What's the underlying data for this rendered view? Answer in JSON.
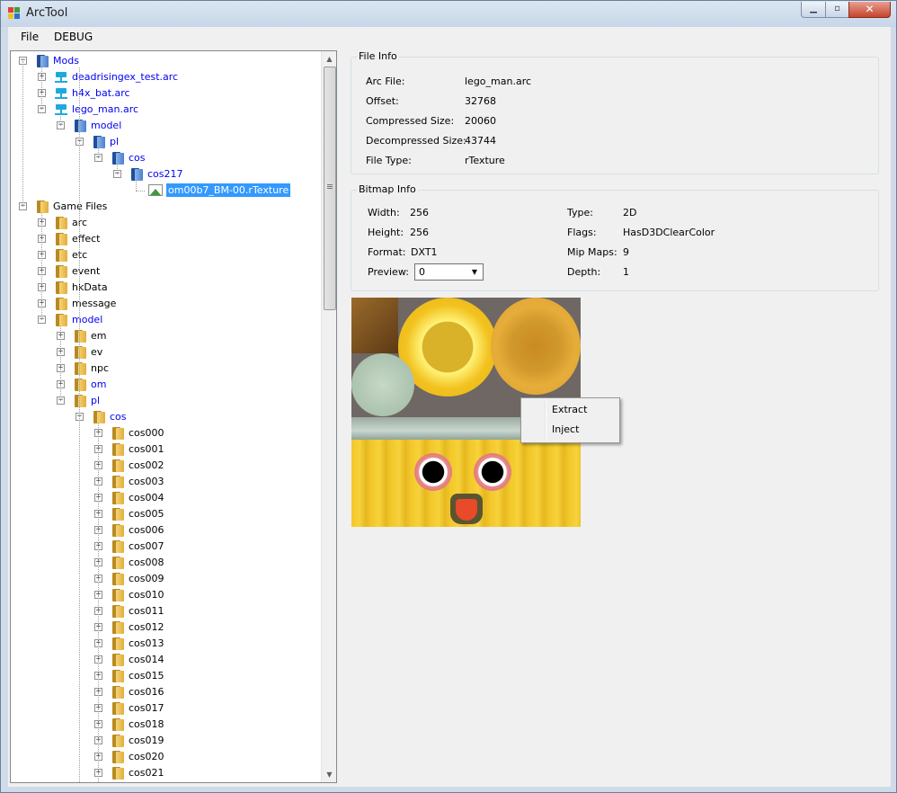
{
  "window": {
    "title": "ArcTool",
    "min_symbol": "▁",
    "max_symbol": "▫",
    "close_symbol": "✕"
  },
  "menu": [
    "File",
    "DEBUG"
  ],
  "tree": {
    "nodes": [
      {
        "label": "Mods",
        "expander": "−",
        "icon": "blue-folder-icon",
        "blue": true
      },
      {
        "label": "deadrisingex_test.arc",
        "expander": "+",
        "icon": "archive-icon",
        "blue": true
      },
      {
        "label": "h4x_bat.arc",
        "expander": "+",
        "icon": "archive-icon",
        "blue": true
      },
      {
        "label": "lego_man.arc",
        "expander": "−",
        "icon": "archive-icon",
        "blue": true
      },
      {
        "label": "model",
        "expander": "−",
        "icon": "blue-folder-icon",
        "blue": true
      },
      {
        "label": "pl",
        "expander": "−",
        "icon": "blue-folder-icon",
        "blue": true
      },
      {
        "label": "cos",
        "expander": "−",
        "icon": "blue-folder-icon",
        "blue": true
      },
      {
        "label": "cos217",
        "expander": "−",
        "icon": "blue-folder-icon",
        "blue": true
      },
      {
        "label": "om00b7_BM-00.rTexture",
        "expander": "",
        "icon": "image-icon",
        "blue": false,
        "selected": true
      },
      {
        "label": "Game Files",
        "expander": "−",
        "icon": "yellow-folder-icon",
        "blue": false
      },
      {
        "label": "arc",
        "expander": "+",
        "icon": "yellow-folder-icon",
        "blue": false
      },
      {
        "label": "effect",
        "expander": "+",
        "icon": "yellow-folder-icon",
        "blue": false
      },
      {
        "label": "etc",
        "expander": "+",
        "icon": "yellow-folder-icon",
        "blue": false
      },
      {
        "label": "event",
        "expander": "+",
        "icon": "yellow-folder-icon",
        "blue": false
      },
      {
        "label": "hkData",
        "expander": "+",
        "icon": "yellow-folder-icon",
        "blue": false
      },
      {
        "label": "message",
        "expander": "+",
        "icon": "yellow-folder-icon",
        "blue": false
      },
      {
        "label": "model",
        "expander": "−",
        "icon": "yellow-folder-icon",
        "blue": true
      },
      {
        "label": "em",
        "expander": "+",
        "icon": "yellow-folder-icon",
        "blue": false
      },
      {
        "label": "ev",
        "expander": "+",
        "icon": "yellow-folder-icon",
        "blue": false
      },
      {
        "label": "npc",
        "expander": "+",
        "icon": "yellow-folder-icon",
        "blue": false
      },
      {
        "label": "om",
        "expander": "+",
        "icon": "yellow-folder-icon",
        "blue": true
      },
      {
        "label": "pl",
        "expander": "−",
        "icon": "yellow-folder-icon",
        "blue": true
      },
      {
        "label": "cos",
        "expander": "−",
        "icon": "yellow-folder-icon",
        "blue": true
      },
      {
        "label": "cos000",
        "expander": "+",
        "icon": "yellow-folder-icon",
        "blue": false
      },
      {
        "label": "cos001",
        "expander": "+",
        "icon": "yellow-folder-icon",
        "blue": false
      },
      {
        "label": "cos002",
        "expander": "+",
        "icon": "yellow-folder-icon",
        "blue": false
      },
      {
        "label": "cos003",
        "expander": "+",
        "icon": "yellow-folder-icon",
        "blue": false
      },
      {
        "label": "cos004",
        "expander": "+",
        "icon": "yellow-folder-icon",
        "blue": false
      },
      {
        "label": "cos005",
        "expander": "+",
        "icon": "yellow-folder-icon",
        "blue": false
      },
      {
        "label": "cos006",
        "expander": "+",
        "icon": "yellow-folder-icon",
        "blue": false
      },
      {
        "label": "cos007",
        "expander": "+",
        "icon": "yellow-folder-icon",
        "blue": false
      },
      {
        "label": "cos008",
        "expander": "+",
        "icon": "yellow-folder-icon",
        "blue": false
      },
      {
        "label": "cos009",
        "expander": "+",
        "icon": "yellow-folder-icon",
        "blue": false
      },
      {
        "label": "cos010",
        "expander": "+",
        "icon": "yellow-folder-icon",
        "blue": false
      },
      {
        "label": "cos011",
        "expander": "+",
        "icon": "yellow-folder-icon",
        "blue": false
      },
      {
        "label": "cos012",
        "expander": "+",
        "icon": "yellow-folder-icon",
        "blue": false
      },
      {
        "label": "cos013",
        "expander": "+",
        "icon": "yellow-folder-icon",
        "blue": false
      },
      {
        "label": "cos014",
        "expander": "+",
        "icon": "yellow-folder-icon",
        "blue": false
      },
      {
        "label": "cos015",
        "expander": "+",
        "icon": "yellow-folder-icon",
        "blue": false
      },
      {
        "label": "cos016",
        "expander": "+",
        "icon": "yellow-folder-icon",
        "blue": false
      },
      {
        "label": "cos017",
        "expander": "+",
        "icon": "yellow-folder-icon",
        "blue": false
      },
      {
        "label": "cos018",
        "expander": "+",
        "icon": "yellow-folder-icon",
        "blue": false
      },
      {
        "label": "cos019",
        "expander": "+",
        "icon": "yellow-folder-icon",
        "blue": false
      },
      {
        "label": "cos020",
        "expander": "+",
        "icon": "yellow-folder-icon",
        "blue": false
      },
      {
        "label": "cos021",
        "expander": "+",
        "icon": "yellow-folder-icon",
        "blue": false
      }
    ]
  },
  "file_info": {
    "title": "File Info",
    "rows": [
      {
        "label": "Arc File:",
        "value": "lego_man.arc"
      },
      {
        "label": "Offset:",
        "value": "32768"
      },
      {
        "label": "Compressed Size:",
        "value": "20060"
      },
      {
        "label": "Decompressed Size:",
        "value": "43744"
      },
      {
        "label": "File Type:",
        "value": "rTexture"
      }
    ]
  },
  "bitmap_info": {
    "title": "Bitmap Info",
    "width_label": "Width:",
    "width_value": "256",
    "height_label": "Height:",
    "height_value": "256",
    "format_label": "Format:",
    "format_value": "DXT1",
    "preview_label": "Preview:",
    "preview_value": "0",
    "type_label": "Type:",
    "type_value": "2D",
    "flags_label": "Flags:",
    "flags_value": "HasD3DClearColor",
    "mipmaps_label": "Mip Maps:",
    "mipmaps_value": "9",
    "depth_label": "Depth:",
    "depth_value": "1"
  },
  "context_menu": {
    "items": [
      "Extract",
      "Inject"
    ]
  },
  "colors": {
    "selection": "#3399ff",
    "link_blue": "#0000ee",
    "window_bg": "#f0f0f0"
  }
}
